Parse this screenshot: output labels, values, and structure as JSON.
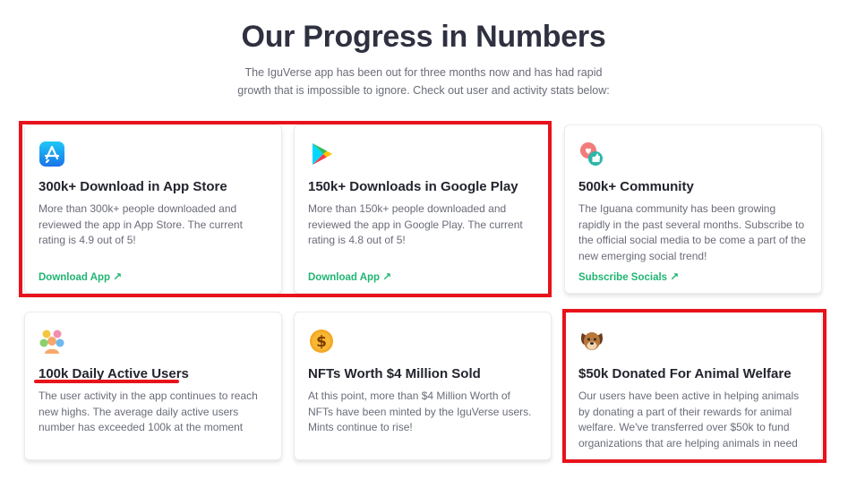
{
  "header": {
    "title": "Our Progress in Numbers",
    "subtitle_line1": "The IguVerse app has been out for three months now and has had rapid",
    "subtitle_line2": "growth that is impossible to ignore. Check out user and activity stats below:"
  },
  "cards": [
    {
      "icon": "app-store-icon",
      "title": "300k+ Download in App Store",
      "desc": "More than 300k+ people downloaded and reviewed the app in App Store. The current rating is 4.9 out of 5!",
      "cta": "Download App"
    },
    {
      "icon": "google-play-icon",
      "title": "150k+ Downloads in Google Play",
      "desc": "More than 150k+ people downloaded and reviewed the app in Google Play. The current rating is 4.8 out of 5!",
      "cta": "Download App"
    },
    {
      "icon": "community-chat-icon",
      "title": "500k+ Community",
      "desc": "The Iguana community has been growing rapidly in the past several months. Subscribe to the official social media to be come a part of the new emerging social trend!",
      "cta": "Subscribe Socials"
    },
    {
      "icon": "users-group-icon",
      "title": "100k Daily Active Users",
      "desc": "The user activity in the app continues to reach new highs. The average daily active users number has exceeded 100k at the moment"
    },
    {
      "icon": "dollar-coin-icon",
      "title": "NFTs Worth $4 Million Sold",
      "desc": "At this point, more than $4 Million Worth of NFTs have been minted by the IguVerse users. Mints continue to rise!"
    },
    {
      "icon": "dog-icon",
      "title": "$50k Donated For Animal Welfare",
      "desc": "Our users have been active in helping animals by donating a part of their rewards for animal welfare. We've transferred over $50k to fund organizations that are helping animals in need"
    }
  ],
  "colors": {
    "accent": "#22b573",
    "highlight": "#e8121b"
  }
}
